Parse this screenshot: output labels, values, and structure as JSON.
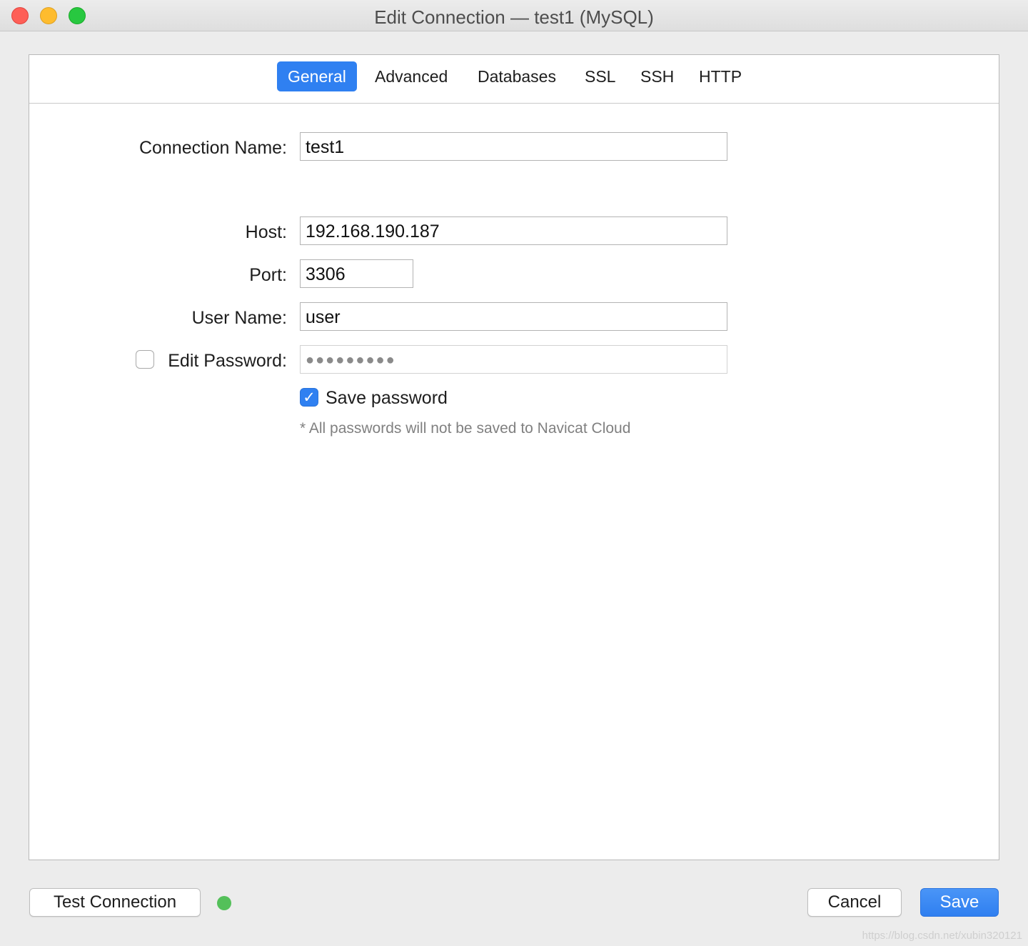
{
  "window": {
    "title": "Edit Connection — test1 (MySQL)"
  },
  "tabs": [
    {
      "label": "General",
      "active": true
    },
    {
      "label": "Advanced",
      "active": false
    },
    {
      "label": "Databases",
      "active": false
    },
    {
      "label": "SSL",
      "active": false
    },
    {
      "label": "SSH",
      "active": false
    },
    {
      "label": "HTTP",
      "active": false
    }
  ],
  "form": {
    "connection_name": {
      "label": "Connection Name:",
      "value": "test1"
    },
    "host": {
      "label": "Host:",
      "value": "192.168.190.187"
    },
    "port": {
      "label": "Port:",
      "value": "3306"
    },
    "user_name": {
      "label": "User Name:",
      "value": "user"
    },
    "edit_password": {
      "label": "Edit Password:",
      "checked": false,
      "value": "●●●●●●●●●"
    },
    "save_password": {
      "label": "Save password",
      "checked": true,
      "check_glyph": "✓"
    },
    "note": "* All passwords will not be saved to Navicat Cloud"
  },
  "footer": {
    "test_connection_label": "Test Connection",
    "status_color": "#54c05a",
    "cancel_label": "Cancel",
    "save_label": "Save"
  },
  "watermark": "https://blog.csdn.net/xubin320121",
  "colors": {
    "accent": "#2f80f1",
    "close": "#fe5f57",
    "minimize": "#febc2e",
    "maximize": "#28c840"
  }
}
